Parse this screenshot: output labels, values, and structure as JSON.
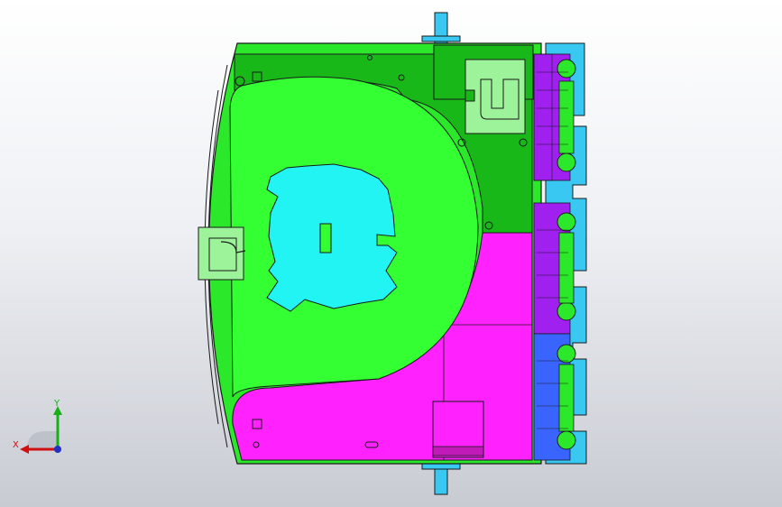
{
  "viewport": {
    "background": "#e6e8ec",
    "triad": {
      "x_label": "X",
      "y_label": "Y",
      "x_color": "#d01010",
      "y_color": "#18b018",
      "z_color": "#2030c0"
    }
  },
  "model": {
    "colors": {
      "outline": "#1a1a1a",
      "green": "#2be82b",
      "green_bright": "#33ff33",
      "green_dark": "#19b819",
      "green_light": "#9df39a",
      "cyan": "#22f3f3",
      "magenta": "#ff22ff",
      "magenta_dark": "#c01ab8",
      "purple": "#a020f0",
      "blue": "#3a64ff",
      "sky": "#38c8f2"
    }
  }
}
